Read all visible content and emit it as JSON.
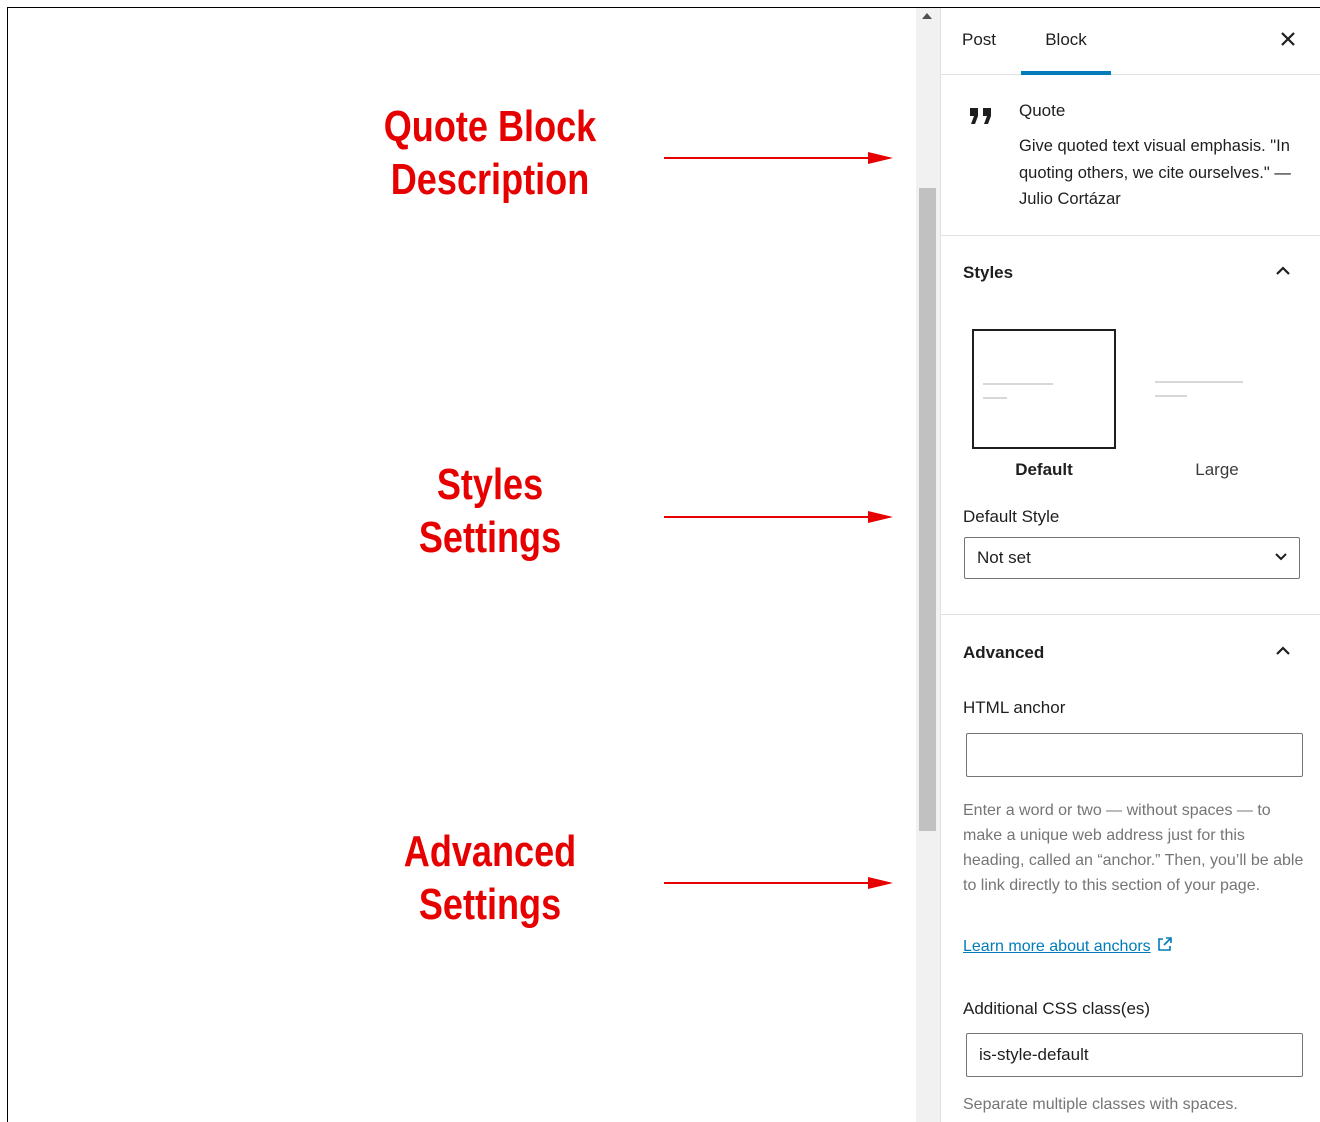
{
  "annotations": [
    {
      "lines": [
        "Quote Block",
        "Description"
      ]
    },
    {
      "lines": [
        "Styles",
        "Settings"
      ]
    },
    {
      "lines": [
        "Advanced",
        "Settings"
      ]
    }
  ],
  "sidebar": {
    "tabs": [
      {
        "label": "Post",
        "active": false
      },
      {
        "label": "Block",
        "active": true
      }
    ],
    "block_card": {
      "icon": "quote-icon",
      "title": "Quote",
      "description": "Give quoted text visual emphasis. \"In quoting others, we cite ourselves.\" — Julio Cortázar"
    },
    "styles_panel": {
      "title": "Styles",
      "options": [
        {
          "label": "Default",
          "selected": true
        },
        {
          "label": "Large",
          "selected": false
        }
      ],
      "default_style_label": "Default Style",
      "default_style_value": "Not set"
    },
    "advanced_panel": {
      "title": "Advanced",
      "html_anchor_label": "HTML anchor",
      "html_anchor_value": "",
      "html_anchor_help": "Enter a word or two — without spaces — to make a unique web address just for this heading, called an “anchor.” Then, you’ll be able to link directly to this section of your page.",
      "learn_more_link": "Learn more about anchors",
      "css_class_label": "Additional CSS class(es)",
      "css_class_value": "is-style-default",
      "css_class_help": "Separate multiple classes with spaces."
    }
  },
  "colors": {
    "annotation_red": "#e60000",
    "accent_blue": "#007cba",
    "help_gray": "#757575"
  }
}
